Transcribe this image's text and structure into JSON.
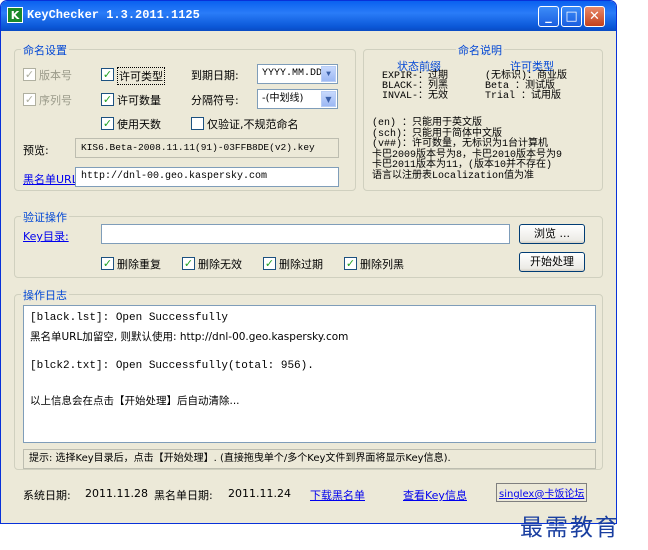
{
  "window": {
    "title": "KeyChecker 1.3.2011.1125",
    "icon_text": "K",
    "minimize_glyph": "_",
    "maximize_glyph": "□",
    "close_glyph": "✕"
  },
  "naming_settings": {
    "legend": "命名设置",
    "version_label": "版本号",
    "serial_label": "序列号",
    "license_type_label": "许可类型",
    "license_count_label": "许可数量",
    "days_used_label": "使用天数",
    "expiry_date_label": "到期日期:",
    "expiry_date_value": "YYYY.MM.DD",
    "separator_label": "分隔符号:",
    "separator_value": "-(中划线)",
    "verify_only_label": "仅验证,不规范命名",
    "preview_label": "预览:",
    "preview_value": "KIS6.Beta-2008.11.11(91)-03FFB8DE(v2).key",
    "blacklist_url_label": "黑名单URL:",
    "blacklist_url_value": "http://dnl-00.geo.kaspersky.com"
  },
  "naming_help": {
    "legend": "命名说明",
    "status_title": "状态前缀",
    "status_lines": [
      "EXPIR-：过期",
      "BLACK-：列黑",
      "INVAL-：无效"
    ],
    "license_title": "许可类型",
    "license_lines": [
      "(无标识)：商业版",
      "Beta  ：测试版",
      "Trial ：试用版"
    ],
    "notes": [
      "(en) ：只能用于英文版",
      "(sch)：只能用于简体中文版",
      "(v##)：许可数量，无标识为1台计算机",
      "卡巴2009版本号为8，卡巴2010版本号为9",
      "卡巴2011版本为11，(版本10并不存在)",
      "语言以注册表Localization值为准"
    ]
  },
  "verify": {
    "legend": "验证操作",
    "key_dir_label": "Key目录:",
    "key_dir_value": "",
    "browse_button": "浏览 ...",
    "delete_duplicate": "删除重复",
    "delete_invalid": "删除无效",
    "delete_expired": "删除过期",
    "delete_blacklisted": "删除列黑",
    "start_button": "开始处理"
  },
  "log": {
    "legend": "操作日志",
    "lines": [
      "[black.lst]: Open Successfully",
      "黑名单URL加留空, 则默认使用: http://dnl-00.geo.kaspersky.com",
      "[blck2.txt]: Open Successfully(total: 956).",
      "以上信息会在点击【开始处理】后自动清除..."
    ]
  },
  "hint": "提示: 选择Key目录后，点击【开始处理】. (直接拖曳单个/多个Key文件到界面将显示Key信息).",
  "footer": {
    "system_date_label": "系统日期:",
    "system_date_value": "2011.11.28",
    "blacklist_date_label": "黑名单日期:",
    "blacklist_date_value": "2011.11.24",
    "download_link": "下载黑名单",
    "view_key_link": "查看Key信息",
    "forum_link": "singlex@卡饭论坛"
  },
  "watermark": "最需教育",
  "colors": {
    "title_bar": "#0a61f0",
    "window_bg": "#ece9d8",
    "legend_blue": "#0046d5",
    "check_green": "#21a121"
  }
}
